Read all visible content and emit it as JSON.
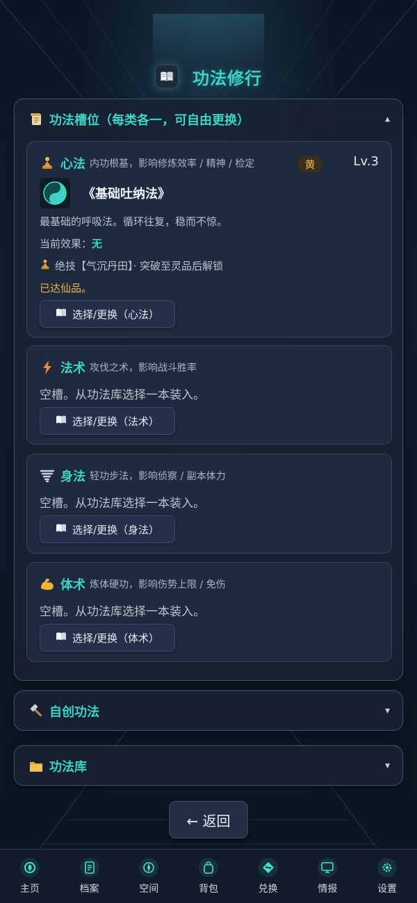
{
  "header": {
    "title": "功法修行",
    "icon": "open-book-icon"
  },
  "slots_panel": {
    "title": "功法槽位（每类各一，可自由更换）",
    "icon": "scroll-icon",
    "caret": "▲",
    "slots": [
      {
        "name": "心法",
        "icon": "meditation-icon",
        "desc": "内功根基，影响修炼效率 / 精神 / 检定",
        "rank": "黄",
        "level": "Lv.3",
        "book_name": "《基础吐纳法》",
        "book_icon": "taiji-icon",
        "book_desc": "最基础的呼吸法。循环往复，稳而不惊。",
        "effect_label": "当前效果：",
        "effect_value": "无",
        "skill_text": "绝技【气沉丹田】· 突破至灵品后解锁",
        "status_text": "已达仙品。",
        "button_label": "选择/更换（心法）"
      },
      {
        "name": "法术",
        "icon": "lightning-icon",
        "desc": "攻伐之术，影响战斗胜率",
        "empty_text": "空槽。从功法库选择一本装入。",
        "button_label": "选择/更换（法术）"
      },
      {
        "name": "身法",
        "icon": "tornado-icon",
        "desc": "轻功步法，影响侦察 / 副本体力",
        "empty_text": "空槽。从功法库选择一本装入。",
        "button_label": "选择/更换（身法）"
      },
      {
        "name": "体术",
        "icon": "muscle-icon",
        "desc": "炼体硬功，影响伤势上限 / 免伤",
        "empty_text": "空槽。从功法库选择一本装入。",
        "button_label": "选择/更换（体术）"
      }
    ]
  },
  "create_panel": {
    "title": "自创功法",
    "icon": "hammer-icon",
    "caret": "▼"
  },
  "library_panel": {
    "title": "功法库",
    "icon": "folder-icon",
    "caret": "▼"
  },
  "back_button": {
    "label": "← 返回"
  },
  "bottom_nav": [
    {
      "label": "主页",
      "icon": "swirl-icon"
    },
    {
      "label": "档案",
      "icon": "document-icon"
    },
    {
      "label": "空间",
      "icon": "compass-icon"
    },
    {
      "label": "背包",
      "icon": "bag-icon"
    },
    {
      "label": "兑换",
      "icon": "exchange-icon"
    },
    {
      "label": "情报",
      "icon": "monitor-icon"
    },
    {
      "label": "设置",
      "icon": "gear-icon"
    }
  ],
  "colors": {
    "accent": "#3fd3c6",
    "gold": "#e8b650",
    "panel_bg": "#182232",
    "card_bg": "#1e2a3d"
  }
}
